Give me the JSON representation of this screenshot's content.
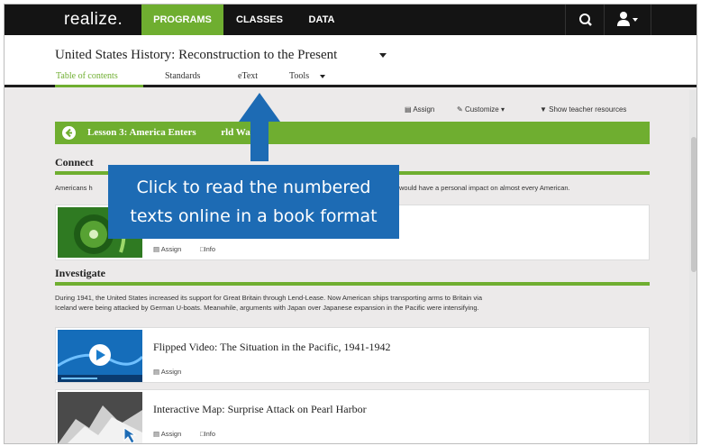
{
  "topnav": {
    "logo": "realize.",
    "items": [
      "PROGRAMS",
      "CLASSES",
      "DATA"
    ],
    "icons": [
      "search-icon",
      "user-icon"
    ],
    "accent": "#6fae30"
  },
  "header": {
    "course_title": "United States History: Reconstruction to the Present",
    "tabs": [
      "Table of contents",
      "Standards",
      "eText",
      "Tools"
    ]
  },
  "actions": {
    "assign": "Assign",
    "customize": "Customize",
    "resources": "Show teacher resources"
  },
  "lesson": {
    "title_left": "Lesson 3: America Enters",
    "title_right": "rld War II"
  },
  "connect": {
    "heading": "Connect",
    "text_left": "Americans h",
    "text_right": "would have a personal impact on almost every American."
  },
  "connect_card": {
    "assign": "Assign",
    "info": "Info"
  },
  "investigate": {
    "heading": "Investigate",
    "text_line1": "During 1941, the United States increased its support for Great Britain through Lend-Lease. Now American ships transporting arms to Britain via",
    "text_line2": "Iceland were being attacked by German U-boats. Meanwhile, arguments with Japan over Japanese expansion in the Pacific were intensifying."
  },
  "cards": [
    {
      "title": "Flipped Video: The Situation in the Pacific, 1941-1942",
      "assign": "Assign"
    },
    {
      "title": "Interactive Map: Surprise Attack on Pearl Harbor",
      "assign": "Assign",
      "info": "Info"
    }
  ],
  "callout": {
    "line1": "Click to read the numbered",
    "line2": "texts online in a book format",
    "color": "#1d6bb4"
  }
}
